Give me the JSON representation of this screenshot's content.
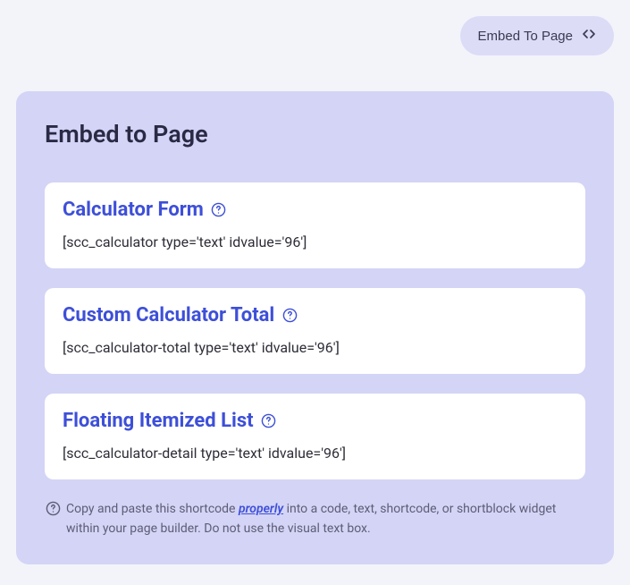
{
  "topbar": {
    "embed_button_label": "Embed To Page"
  },
  "panel": {
    "title": "Embed to Page",
    "cards": [
      {
        "title": "Calculator Form",
        "shortcode": "[scc_calculator type='text' idvalue='96']"
      },
      {
        "title": "Custom Calculator Total",
        "shortcode": "[scc_calculator-total type='text' idvalue='96']"
      },
      {
        "title": "Floating Itemized List",
        "shortcode": "[scc_calculator-detail type='text' idvalue='96']"
      }
    ],
    "footer": {
      "pre": "Copy and paste this shortcode ",
      "link": "properly",
      "post": " into a code, text, shortcode, or shortblock widget within your page builder. Do not use the visual text box."
    }
  }
}
